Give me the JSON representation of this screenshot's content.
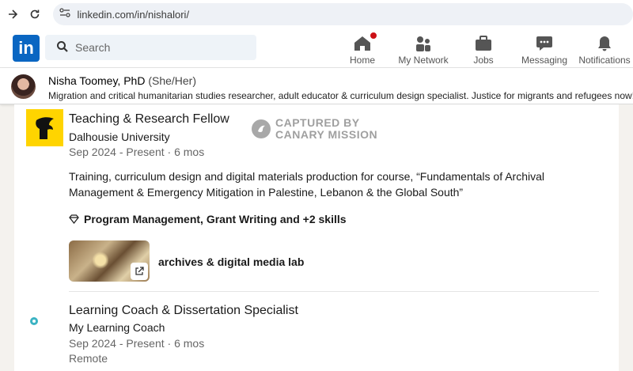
{
  "browser": {
    "url": "linkedin.com/in/nishalori/"
  },
  "header": {
    "logo_text": "in",
    "search_placeholder": "Search",
    "nav": [
      {
        "label": "Home",
        "icon": "home-icon"
      },
      {
        "label": "My Network",
        "icon": "network-icon"
      },
      {
        "label": "Jobs",
        "icon": "briefcase-icon"
      },
      {
        "label": "Messaging",
        "icon": "messaging-icon"
      },
      {
        "label": "Notifications",
        "icon": "bell-icon"
      }
    ]
  },
  "profile_bar": {
    "name": "Nisha Toomey, PhD",
    "pronouns": "(She/Her)",
    "headline": "Migration and critical humanitarian studies researcher, adult educator & curriculum design specialist. Justice for migrants and refugees now!"
  },
  "watermark": {
    "line1": "CAPTURED BY",
    "line2": "CANARY MISSION"
  },
  "experience": [
    {
      "title": "Teaching & Research Fellow",
      "org": "Dalhousie University",
      "dates": "Sep 2024 - Present · 6 mos",
      "description": "Training, curriculum design and digital materials production for course, “Fundamentals of Archival Management & Emergency Mitigation in Palestine, Lebanon & the Global South”",
      "skills": "Program Management, Grant Writing and +2 skills",
      "media_label": "archives & digital media lab"
    },
    {
      "title": "Learning Coach & Dissertation Specialist",
      "org": "My Learning Coach",
      "logo_text": "MY LEARNING COACH",
      "dates": "Sep 2024 - Present · 6 mos",
      "location": "Remote"
    }
  ],
  "colors": {
    "linkedin_blue": "#0a66c2",
    "dal_yellow": "#ffd400",
    "notification_red": "#cc1016"
  }
}
